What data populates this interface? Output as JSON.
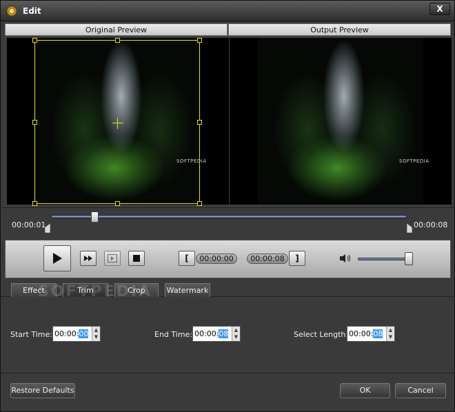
{
  "window": {
    "title": "Edit",
    "close_label": "X"
  },
  "preview": {
    "original_label": "Original Preview",
    "output_label": "Output Preview",
    "video_watermark": "SOFTPEDIA"
  },
  "timeline": {
    "start_time": "00:00:01",
    "end_time": "00:00:08"
  },
  "controls": {
    "mark_in_label": "[",
    "mark_out_label": "]",
    "segment_start": "00:00:00",
    "segment_end": "00:00:08"
  },
  "tabs": [
    {
      "label": "Effect"
    },
    {
      "label": "Trim"
    },
    {
      "label": "Crop"
    },
    {
      "label": "Watermark"
    }
  ],
  "background_watermark": "SOFTPEDIA",
  "trim": {
    "start_label": "Start Time:",
    "start_value_prefix": "00:00:",
    "start_value_selected": "00",
    "end_label": "End Time:",
    "end_value_prefix": "00:00:",
    "end_value_selected": "08",
    "length_label": "Select Length:",
    "length_value_prefix": "00:00:",
    "length_value_selected": "08"
  },
  "footer": {
    "restore_label": "Restore Defaults",
    "ok_label": "OK",
    "cancel_label": "Cancel"
  },
  "colors": {
    "crop_frame": "#e6e600",
    "selection": "#3399ff",
    "slider_track": "#4f6a9a"
  }
}
